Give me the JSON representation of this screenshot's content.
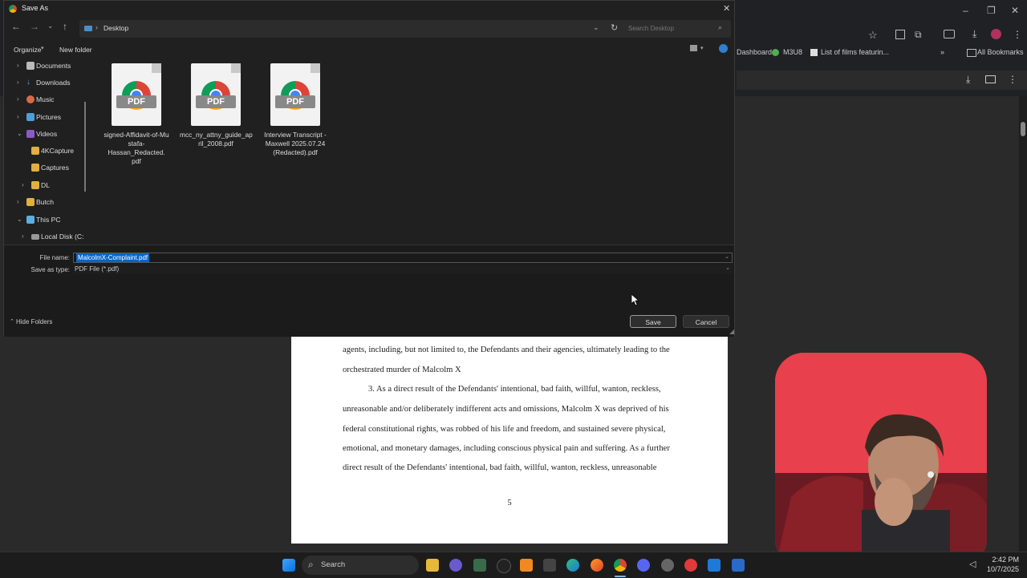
{
  "browser": {
    "bookmarks": [
      "Dashboard",
      "M3U8",
      "List of films featurin...",
      "All Bookmarks"
    ],
    "more_glyph": "»"
  },
  "pdf": {
    "lines": [
      "agents, including, but not limited to, the Defendants and their agencies, ultimately leading to the",
      "orchestrated murder of Malcolm X",
      "3.        As a direct result of the Defendants' intentional, bad faith, willful, wanton, reckless,",
      "unreasonable and/or deliberately indifferent acts and omissions, Malcolm X was deprived of his",
      "federal constitutional rights, was robbed of his life and freedom, and sustained severe physical,",
      "emotional, and monetary damages, including conscious physical pain and suffering. As a further",
      "direct result of the Defendants' intentional, bad faith, willful, wanton, reckless, unreasonable"
    ],
    "page_number": "5"
  },
  "dialog": {
    "title": "Save As",
    "close_glyph": "✕",
    "address": "Desktop",
    "search_placeholder": "Search Desktop",
    "organize_label": "Organize",
    "new_folder_label": "New folder",
    "nav_items": [
      {
        "label": "Documents",
        "chevron": "›",
        "icon": "documents-icon"
      },
      {
        "label": "Downloads",
        "chevron": "›",
        "icon": "downloads-icon"
      },
      {
        "label": "Music",
        "chevron": "›",
        "icon": "music-icon"
      },
      {
        "label": "Pictures",
        "chevron": "›",
        "icon": "pictures-icon"
      },
      {
        "label": "Videos",
        "chevron": "⌄",
        "icon": "videos-icon"
      },
      {
        "label": "4KCapture",
        "chevron": "",
        "icon": "folder-icon"
      },
      {
        "label": "Captures",
        "chevron": "",
        "icon": "folder-icon"
      },
      {
        "label": "DL",
        "chevron": "›",
        "icon": "folder-icon"
      },
      {
        "label": "Butch",
        "chevron": "›",
        "icon": "folder-icon"
      },
      {
        "label": "This PC",
        "chevron": "⌄",
        "icon": "pc-icon"
      },
      {
        "label": "Local Disk (C:",
        "chevron": "›",
        "icon": "drive-icon"
      }
    ],
    "files": [
      {
        "line1": "signed-Affidavit-of-Mu",
        "line2": "stafa-Hassan_Redacted.",
        "line3": "pdf"
      },
      {
        "line1": "mcc_ny_attny_guide_ap",
        "line2": "ril_2008.pdf",
        "line3": ""
      },
      {
        "line1": "Interview Transcript -",
        "line2": "Maxwell 2025.07.24",
        "line3": "(Redacted).pdf"
      }
    ],
    "pdf_badge": "PDF",
    "file_name_label": "File name:",
    "file_name_value": "MalcolmX-Complaint.pdf",
    "save_type_label": "Save as type:",
    "save_type_value": "PDF File (*.pdf)",
    "hide_folders_label": "Hide Folders",
    "save_label": "Save",
    "cancel_label": "Cancel"
  },
  "taskbar": {
    "search_label": "Search",
    "time": "2:42 PM",
    "date": "10/7/2025"
  },
  "colors": {
    "accent": "#0a64c8",
    "dialog_bg": "#202020",
    "webcam_bg": "#e63c4a"
  }
}
